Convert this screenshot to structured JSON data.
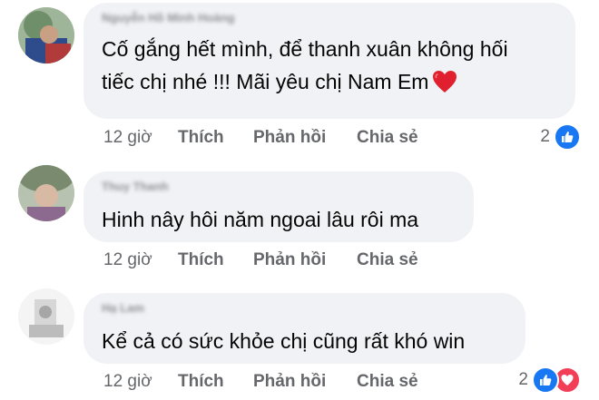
{
  "comments": [
    {
      "author": "Nguyễn Hồ Minh Hoàng",
      "lines": [
        "Cố gắng hết mình, để thanh xuân không hối",
        "tiếc chị nhé !!! Mãi yêu chị Nam Em"
      ],
      "has_heart_emoji": true,
      "time": "12 giờ",
      "like_label": "Thích",
      "reply_label": "Phản hồi",
      "share_label": "Chia sẻ",
      "reaction_count": "2",
      "reactions": [
        "like-icon"
      ]
    },
    {
      "author": "Thuy Thanh",
      "lines": [
        "Hinh nây hôi năm ngoai lâu rôi ma"
      ],
      "has_heart_emoji": false,
      "time": "12 giờ",
      "like_label": "Thích",
      "reply_label": "Phản hồi",
      "share_label": "Chia sẻ",
      "reaction_count": "",
      "reactions": []
    },
    {
      "author": "Hạ Lam",
      "lines": [
        "Kể cả có sức khỏe chị cũng rất khó win"
      ],
      "has_heart_emoji": false,
      "time": "12 giờ",
      "like_label": "Thích",
      "reply_label": "Phản hồi",
      "share_label": "Chia sẻ",
      "reaction_count": "2",
      "reactions": [
        "like-icon",
        "love-icon"
      ]
    }
  ],
  "colors": {
    "bubble": "#f0f2f5",
    "secondary_text": "#65676b",
    "like_blue": "#1877f2",
    "love_red": "#f33e58",
    "heart_emoji": "#e0202e"
  }
}
